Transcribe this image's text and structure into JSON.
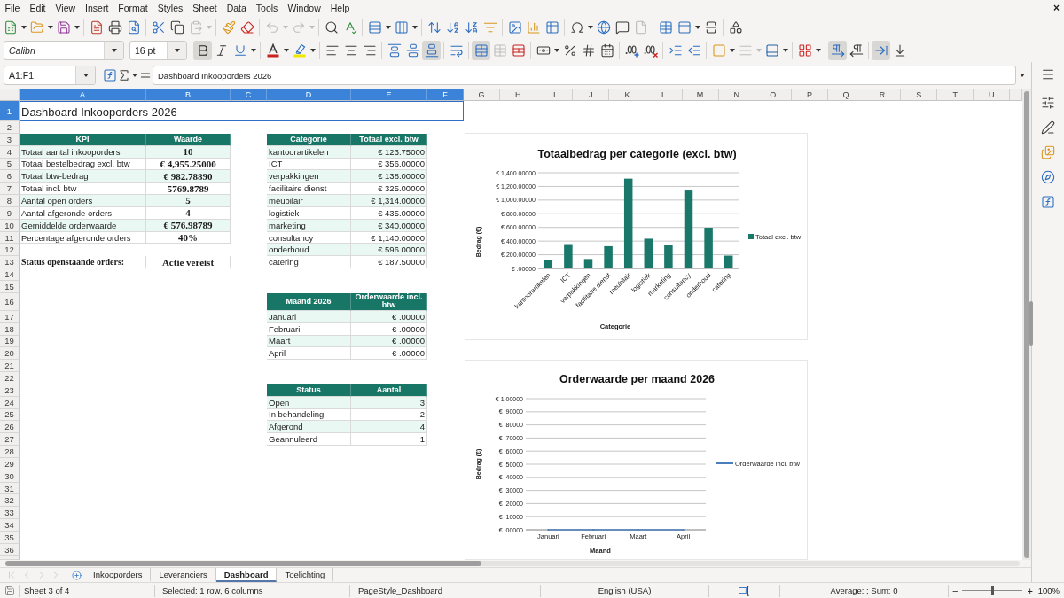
{
  "menu_bar": {
    "items": [
      "File",
      "Edit",
      "View",
      "Insert",
      "Format",
      "Styles",
      "Sheet",
      "Data",
      "Tools",
      "Window",
      "Help"
    ],
    "close": "×"
  },
  "standard_toolbar": {
    "paste_disabled": true,
    "undo_disabled": true,
    "redo_disabled": true
  },
  "formatting_toolbar": {
    "font_name": "Calibri",
    "font_size": "16 pt",
    "bold": true,
    "italic": false,
    "underline": false,
    "align_left": false,
    "align_center": false,
    "align_right": false,
    "align_top": false,
    "align_middle": false,
    "align_bottom": true,
    "wrap_text": false,
    "merge_and_center": true,
    "merge_cells": false,
    "merge_cells_disabled": true,
    "unmerge_cells": false,
    "border_style_disabled": true,
    "left_to_right": true,
    "right_to_left": false,
    "text_horizontal": true,
    "text_vertical": false
  },
  "formula_bar": {
    "name_box": "A1:F1",
    "formula": "Dashboard Inkooporders 2026"
  },
  "sheet": {
    "columns": [
      {
        "label": "A",
        "selected": true
      },
      {
        "label": "B",
        "selected": true
      },
      {
        "label": "C",
        "selected": true
      },
      {
        "label": "D",
        "selected": true
      },
      {
        "label": "E",
        "selected": true
      },
      {
        "label": "F",
        "selected": true
      },
      {
        "label": "G",
        "selected": false
      },
      {
        "label": "H",
        "selected": false
      },
      {
        "label": "I",
        "selected": false
      },
      {
        "label": "J",
        "selected": false
      },
      {
        "label": "K",
        "selected": false
      },
      {
        "label": "L",
        "selected": false
      },
      {
        "label": "M",
        "selected": false
      },
      {
        "label": "N",
        "selected": false
      },
      {
        "label": "O",
        "selected": false
      },
      {
        "label": "P",
        "selected": false
      },
      {
        "label": "Q",
        "selected": false
      },
      {
        "label": "R",
        "selected": false
      },
      {
        "label": "S",
        "selected": false
      },
      {
        "label": "T",
        "selected": false
      },
      {
        "label": "U",
        "selected": false
      }
    ],
    "rows": [
      {
        "label": "1",
        "selected": true
      },
      {
        "label": "2",
        "selected": false
      },
      {
        "label": "3",
        "selected": false
      },
      {
        "label": "4",
        "selected": false
      },
      {
        "label": "5",
        "selected": false
      },
      {
        "label": "6",
        "selected": false
      },
      {
        "label": "7",
        "selected": false
      },
      {
        "label": "8",
        "selected": false
      },
      {
        "label": "9",
        "selected": false
      },
      {
        "label": "10",
        "selected": false
      },
      {
        "label": "11",
        "selected": false
      },
      {
        "label": "12",
        "selected": false
      },
      {
        "label": "13",
        "selected": false
      },
      {
        "label": "14",
        "selected": false
      },
      {
        "label": "15",
        "selected": false
      },
      {
        "label": "16",
        "selected": false
      },
      {
        "label": "17",
        "selected": false
      },
      {
        "label": "18",
        "selected": false
      },
      {
        "label": "19",
        "selected": false
      },
      {
        "label": "20",
        "selected": false
      },
      {
        "label": "21",
        "selected": false
      },
      {
        "label": "22",
        "selected": false
      },
      {
        "label": "23",
        "selected": false
      },
      {
        "label": "24",
        "selected": false
      },
      {
        "label": "25",
        "selected": false
      },
      {
        "label": "26",
        "selected": false
      },
      {
        "label": "27",
        "selected": false
      },
      {
        "label": "28",
        "selected": false
      },
      {
        "label": "29",
        "selected": false
      },
      {
        "label": "30",
        "selected": false
      },
      {
        "label": "31",
        "selected": false
      },
      {
        "label": "32",
        "selected": false
      },
      {
        "label": "33",
        "selected": false
      },
      {
        "label": "34",
        "selected": false
      },
      {
        "label": "35",
        "selected": false
      },
      {
        "label": "36",
        "selected": false
      }
    ],
    "title": "Dashboard Inkooporders 2026",
    "kpi_table": {
      "columns": [
        "KPI",
        "Waarde"
      ],
      "rows": [
        {
          "label": "Totaal aantal inkooporders",
          "value": "10"
        },
        {
          "label": "Totaal bestelbedrag excl. btw",
          "value": "€ 4,955.25000"
        },
        {
          "label": "Totaal btw-bedrag",
          "value": "€ 982.78890"
        },
        {
          "label": "Totaal incl. btw",
          "value": "5769.8789"
        },
        {
          "label": "Aantal open orders",
          "value": "5"
        },
        {
          "label": "Aantal afgeronde orders",
          "value": "4"
        },
        {
          "label": "Gemiddelde orderwaarde",
          "value": "€ 576.98789"
        },
        {
          "label": "Percentage afgeronde orders",
          "value": "40%"
        }
      ]
    },
    "status_summary": {
      "label": "Status openstaande orders:",
      "value": "Actie vereist"
    },
    "category_table": {
      "columns": [
        "Categorie",
        "Totaal excl. btw"
      ],
      "rows": [
        {
          "label": "kantoorartikelen",
          "value": "€ 123.75000"
        },
        {
          "label": "ICT",
          "value": "€ 356.00000"
        },
        {
          "label": "verpakkingen",
          "value": "€ 138.00000"
        },
        {
          "label": "facilitaire dienst",
          "value": "€ 325.00000"
        },
        {
          "label": "meubilair",
          "value": "€ 1,314.00000"
        },
        {
          "label": "logistiek",
          "value": "€ 435.00000"
        },
        {
          "label": "marketing",
          "value": "€ 340.00000"
        },
        {
          "label": "consultancy",
          "value": "€ 1,140.00000"
        },
        {
          "label": "onderhoud",
          "value": "€ 596.00000"
        },
        {
          "label": "catering",
          "value": "€ 187.50000"
        }
      ]
    },
    "month_table": {
      "columns": [
        "Maand 2026",
        "Orderwaarde incl. btw"
      ],
      "rows": [
        {
          "label": "Januari",
          "value": "€ .00000"
        },
        {
          "label": "Februari",
          "value": "€ .00000"
        },
        {
          "label": "Maart",
          "value": "€ .00000"
        },
        {
          "label": "April",
          "value": "€ .00000"
        }
      ]
    },
    "status_table": {
      "columns": [
        "Status",
        "Aantal"
      ],
      "rows": [
        {
          "label": "Open",
          "value": "3"
        },
        {
          "label": "In behandeling",
          "value": "2"
        },
        {
          "label": "Afgerond",
          "value": "4"
        },
        {
          "label": "Geannuleerd",
          "value": "1"
        }
      ]
    },
    "charts": [
      {
        "chart_data": {
          "type": "bar",
          "title": "Totaalbedrag per categorie (excl. btw)",
          "xlabel": "Categorie",
          "ylabel": "Bedrag (€)",
          "categories": [
            "kantoorartikelen",
            "ICT",
            "verpakkingen",
            "facilitaire dienst",
            "meubilair",
            "logistiek",
            "marketing",
            "consultancy",
            "onderhoud",
            "catering"
          ],
          "series": [
            {
              "name": "Totaal excl. btw",
              "color": "#1a786a",
              "values": [
                123.75,
                356,
                138,
                325,
                1314,
                435,
                340,
                1140,
                596,
                187.5
              ]
            }
          ],
          "ylim": [
            0,
            1400
          ],
          "yticks": [
            {
              "value": 0,
              "label": "€ .00000"
            },
            {
              "value": 200,
              "label": "€ 200.00000"
            },
            {
              "value": 400,
              "label": "€ 400.00000"
            },
            {
              "value": 600,
              "label": "€ 600.00000"
            },
            {
              "value": 800,
              "label": "€ 800.00000"
            },
            {
              "value": 1000,
              "label": "€ 1,000.00000"
            },
            {
              "value": 1200,
              "label": "€ 1,200.00000"
            },
            {
              "value": 1400,
              "label": "€ 1,400.00000"
            }
          ],
          "grid": true
        }
      },
      {
        "chart_data": {
          "type": "line",
          "title": "Orderwaarde per maand 2026",
          "xlabel": "Maand",
          "ylabel": "Bedrag (€)",
          "categories": [
            "Januari",
            "Februari",
            "Maart",
            "April"
          ],
          "series": [
            {
              "name": "Orderwaarde incl. btw",
              "color": "#4a7ebb",
              "values": [
                0,
                0,
                0,
                0
              ]
            }
          ],
          "ylim": [
            0,
            1
          ],
          "yticks": [
            {
              "value": 0,
              "label": "€ .00000"
            },
            {
              "value": 0.1,
              "label": "€ .10000"
            },
            {
              "value": 0.2,
              "label": "€ .20000"
            },
            {
              "value": 0.3,
              "label": "€ .30000"
            },
            {
              "value": 0.4,
              "label": "€ .40000"
            },
            {
              "value": 0.5,
              "label": "€ .50000"
            },
            {
              "value": 0.6,
              "label": "€ .60000"
            },
            {
              "value": 0.7,
              "label": "€ .70000"
            },
            {
              "value": 0.8,
              "label": "€ .80000"
            },
            {
              "value": 0.9,
              "label": "€ .90000"
            },
            {
              "value": 1,
              "label": "€ 1.00000"
            }
          ],
          "grid": true
        }
      }
    ]
  },
  "sheet_tabs": {
    "navigation_disabled": true,
    "tabs": [
      {
        "label": "Inkooporders",
        "selected": false
      },
      {
        "label": "Leveranciers",
        "selected": false
      },
      {
        "label": "Dashboard",
        "selected": true
      },
      {
        "label": "Toelichting",
        "selected": false
      }
    ]
  },
  "status_bar": {
    "sheet": "Sheet 3 of 4",
    "selection": "Selected: 1 row, 6 columns",
    "page_style": "PageStyle_Dashboard",
    "language": "English (USA)",
    "summary": "Average: ; Sum: 0",
    "zoom": {
      "minus": "−",
      "plus": "+",
      "level": 0.5,
      "label": "100%"
    }
  }
}
